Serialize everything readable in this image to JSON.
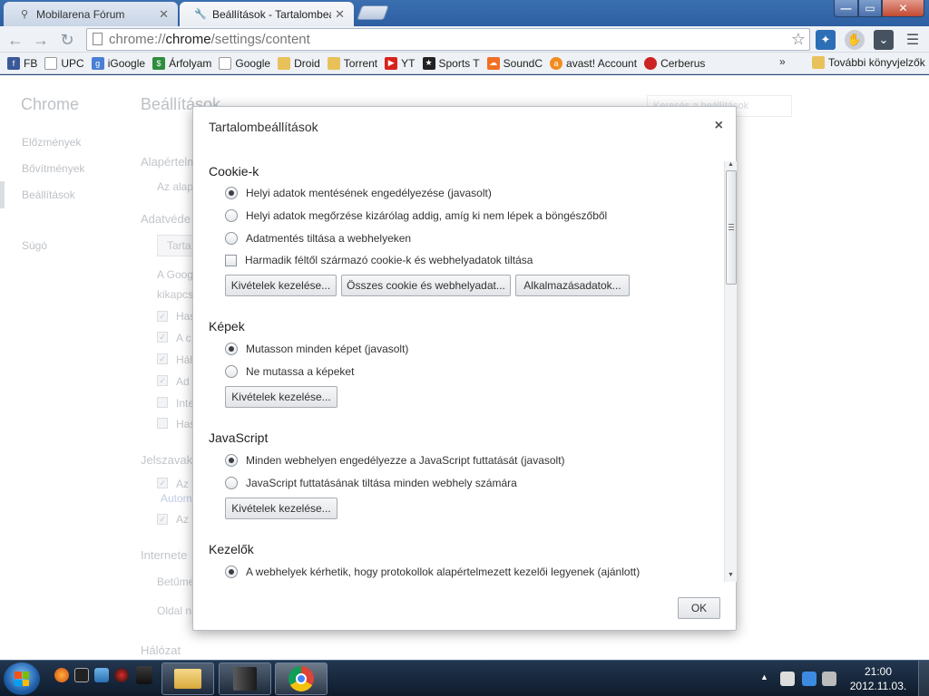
{
  "tabs": [
    {
      "title": "Mobilarena Fórum",
      "close": "✕"
    },
    {
      "title": "Beállítások - Tartalombeállí",
      "close": "✕"
    }
  ],
  "window_controls": {
    "minimize": "—",
    "maximize": "▭",
    "close": "✕"
  },
  "address_bar": {
    "scheme": "chrome://",
    "host": "chrome",
    "path": "/settings/content"
  },
  "bookmarks": [
    "FB",
    "UPC",
    "iGoogle",
    "Árfolyam",
    "Google",
    "Droid",
    "Torrent",
    "YT",
    "Sports T",
    "SoundC",
    "avast! Account",
    "Cerberus"
  ],
  "bookmarks_more": "»",
  "other_bookmarks": "További könyvjelzők",
  "settings_page": {
    "app_title": "Chrome",
    "nav": [
      "Előzmények",
      "Bővítmények",
      "Beállítások",
      "Súgó"
    ],
    "title": "Beállítások",
    "search_placeholder": "Keresés a beállítások",
    "sections": [
      "Alapértelm",
      "Adatvéde",
      "Jelszavak",
      "Internete",
      "Hálózat"
    ],
    "snippets": [
      "Az alap",
      "Tarta",
      "A Goog",
      "kikapcs",
      "Has",
      "A c",
      "Hál",
      "Ad",
      "Inte",
      "Has",
      "Az a",
      "Autom",
      "Az a",
      "Betűme",
      "Oldal n"
    ]
  },
  "dialog": {
    "title": "Tartalombeállítások",
    "close": "×",
    "sections": [
      {
        "heading": "Cookie-k",
        "options": [
          {
            "label": "Helyi adatok mentésének engedélyezése (javasolt)",
            "checked": true
          },
          {
            "label": "Helyi adatok megőrzése kizárólag addig, amíg ki nem lépek a böngészőből",
            "checked": false
          },
          {
            "label": "Adatmentés tiltása a webhelyeken",
            "checked": false
          }
        ],
        "checkbox": {
          "label": "Harmadik féltől származó cookie-k és webhelyadatok tiltása",
          "checked": false
        },
        "buttons": [
          "Kivételek kezelése...",
          "Összes cookie és webhelyadat...",
          "Alkalmazásadatok..."
        ]
      },
      {
        "heading": "Képek",
        "options": [
          {
            "label": "Mutasson minden képet (javasolt)",
            "checked": true
          },
          {
            "label": "Ne mutassa a képeket",
            "checked": false
          }
        ],
        "buttons": [
          "Kivételek kezelése..."
        ]
      },
      {
        "heading": "JavaScript",
        "options": [
          {
            "label": "Minden webhelyen engedélyezze a JavaScript futtatását (javasolt)",
            "checked": true
          },
          {
            "label": "JavaScript futtatásának tiltása minden webhely számára",
            "checked": false
          }
        ],
        "buttons": [
          "Kivételek kezelése..."
        ]
      },
      {
        "heading": "Kezelők",
        "options": [
          {
            "label": "A webhelyek kérhetik, hogy protokollok alapértelmezett kezelői legyenek (ajánlott)",
            "checked": true
          }
        ]
      }
    ],
    "ok_label": "OK"
  },
  "taskbar": {
    "tray_arrow": "▲",
    "clock_time": "21:00",
    "clock_date": "2012.11.03."
  }
}
